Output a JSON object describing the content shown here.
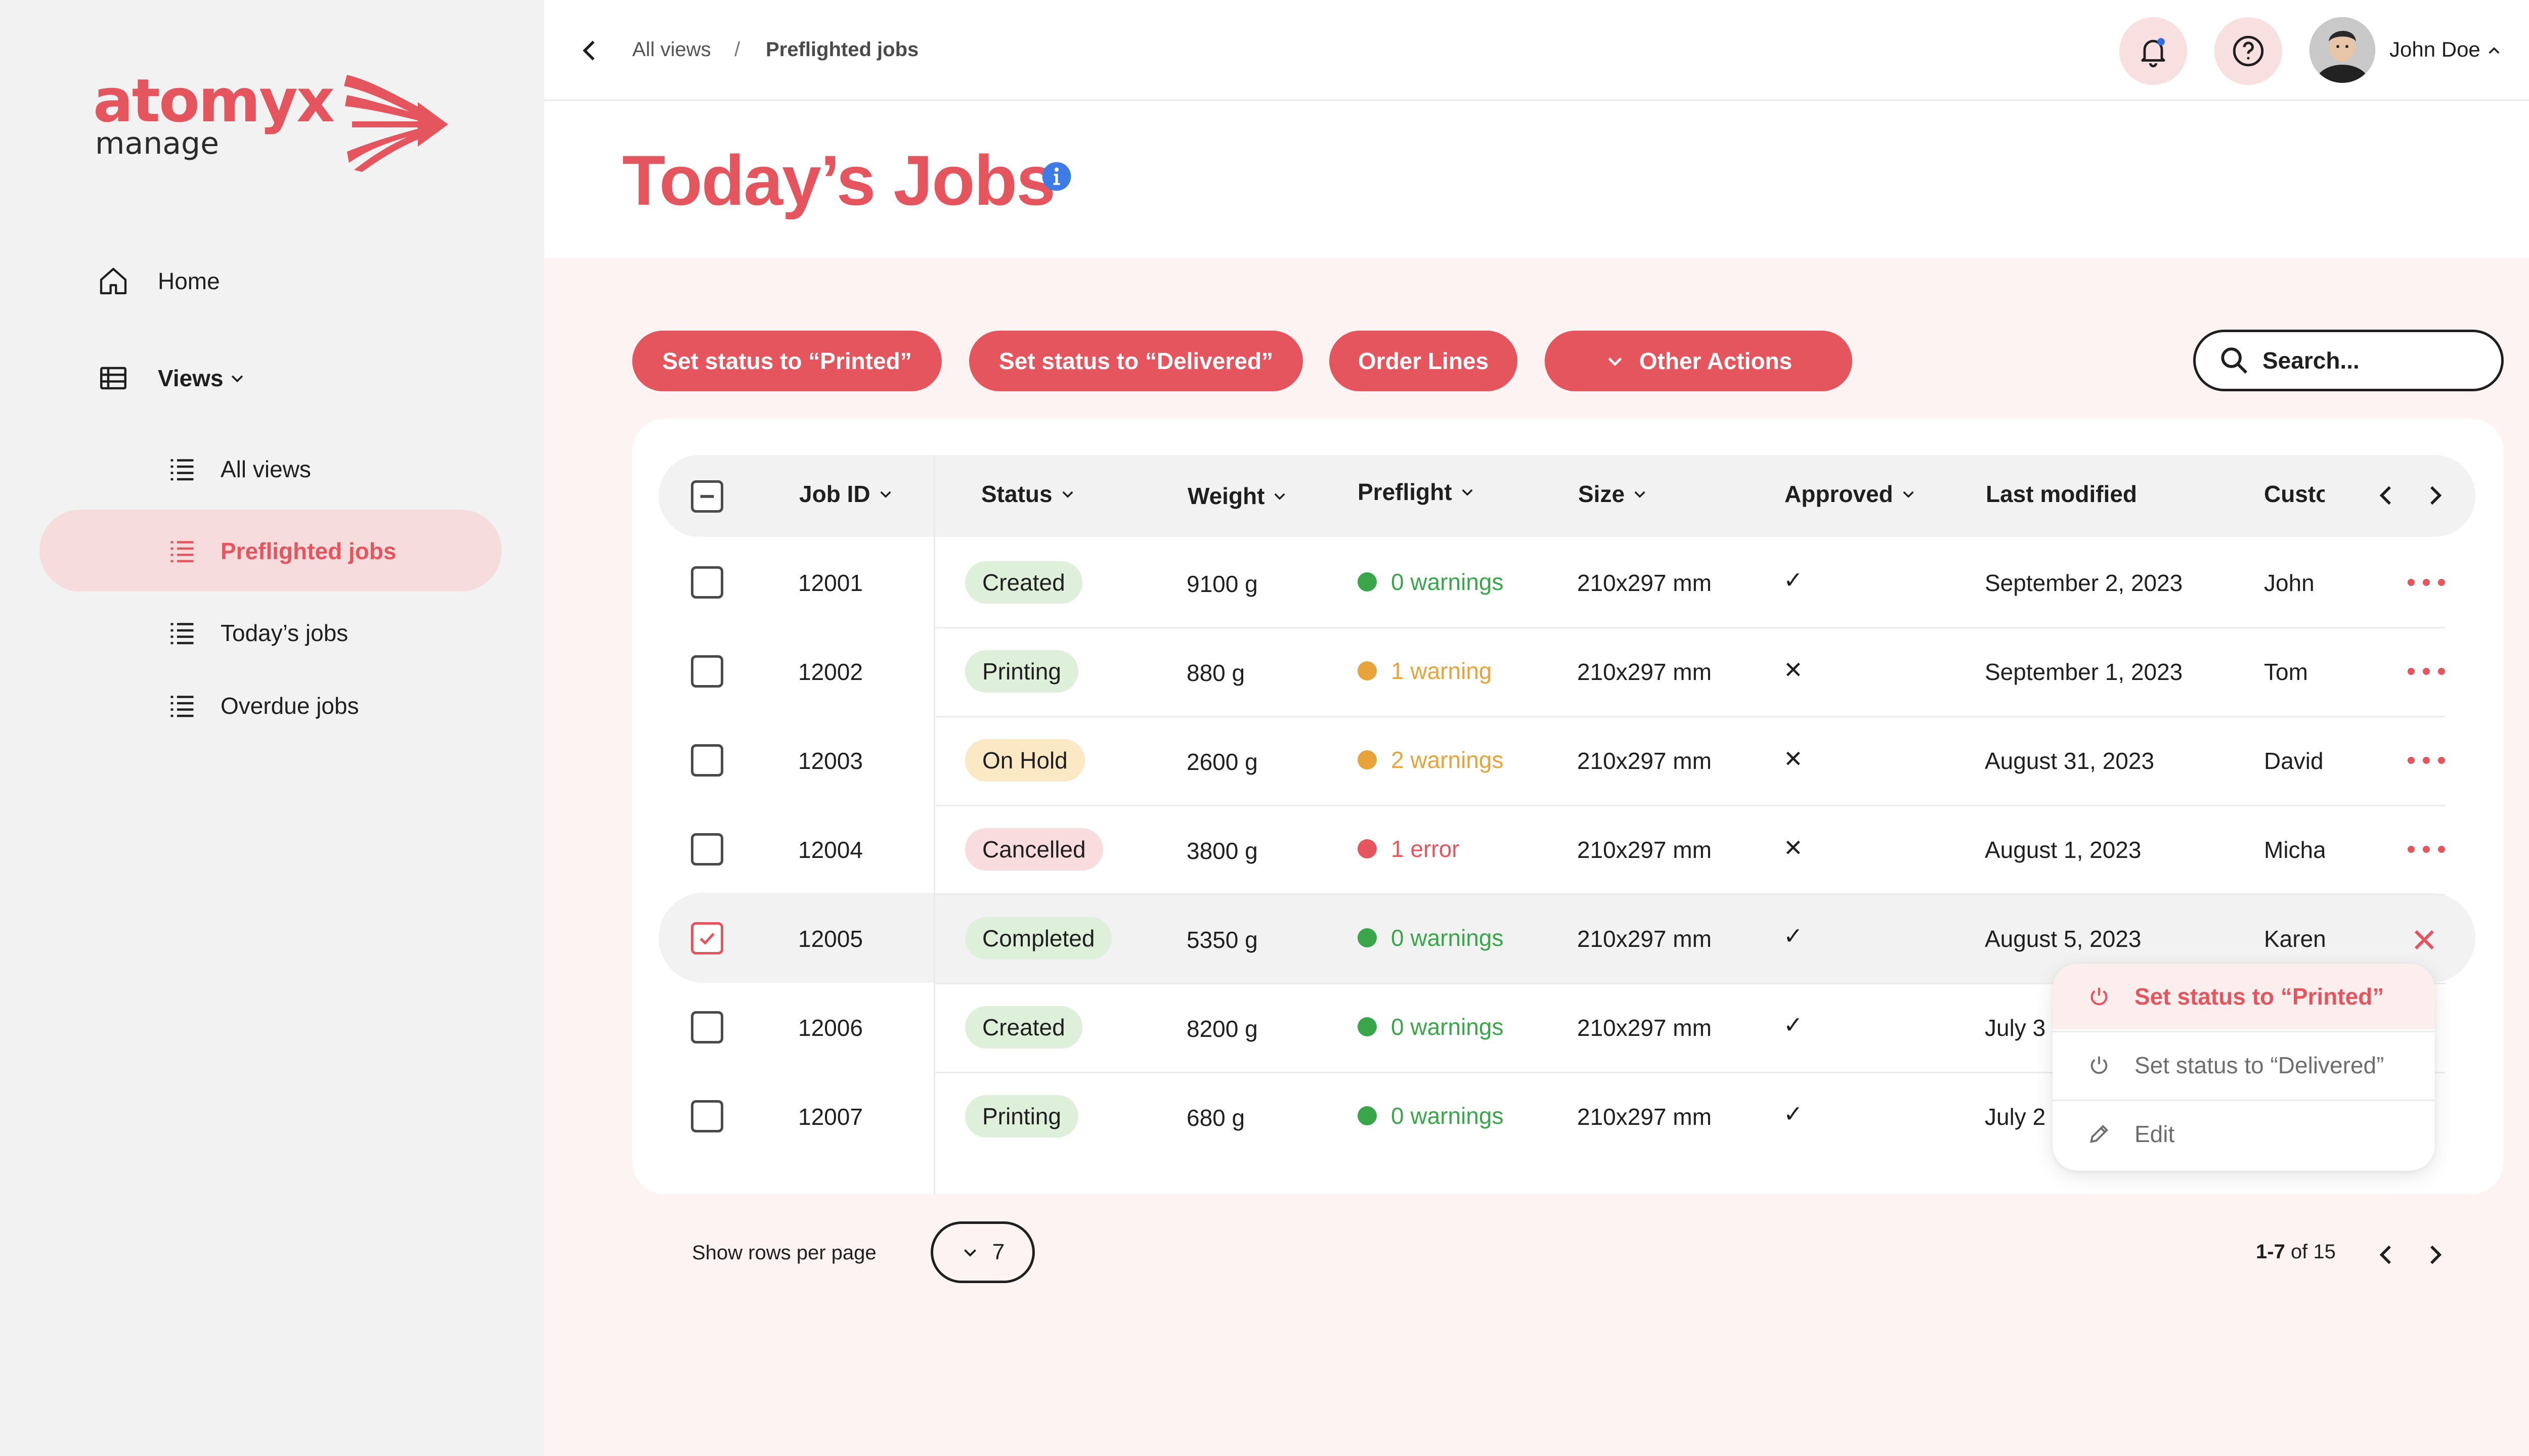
{
  "brand": {
    "name": "atomyx",
    "product": "manage",
    "accent": "#e4555d"
  },
  "sidebar": {
    "home": "Home",
    "views": "Views",
    "items": [
      {
        "label": "All views",
        "icon": "list-icon"
      },
      {
        "label": "Preflighted jobs",
        "icon": "list-icon",
        "active": true
      },
      {
        "label": "Today’s jobs",
        "icon": "list-icon"
      },
      {
        "label": "Overdue jobs",
        "icon": "list-icon"
      }
    ]
  },
  "breadcrumb": {
    "root": "All views",
    "separator": "/",
    "current": "Preflighted jobs"
  },
  "user": {
    "name": "John Doe"
  },
  "page": {
    "title": "Today’s Jobs"
  },
  "actions": {
    "printed": "Set status to “Printed”",
    "delivered": "Set status to “Delivered”",
    "order_lines": "Order Lines",
    "other": "Other Actions"
  },
  "search": {
    "placeholder": "Search..."
  },
  "table": {
    "headers": {
      "job_id": "Job ID",
      "status": "Status",
      "weight": "Weight",
      "preflight": "Preflight",
      "size": "Size",
      "approved": "Approved",
      "last_modified": "Last modified",
      "customer": "Customer"
    },
    "rows": [
      {
        "id": "12001",
        "status": "Created",
        "weight": "9100 g",
        "preflight": "0 warnings",
        "size": "210x297 mm",
        "approved": "✓",
        "modified": "September 2, 2023",
        "customer": "John"
      },
      {
        "id": "12002",
        "status": "Printing",
        "weight": "880 g",
        "preflight": "1 warning",
        "size": "210x297 mm",
        "approved": "✕",
        "modified": "September 1, 2023",
        "customer": "Tom"
      },
      {
        "id": "12003",
        "status": "On Hold",
        "weight": "2600 g",
        "preflight": "2 warnings",
        "size": "210x297 mm",
        "approved": "✕",
        "modified": "August 31, 2023",
        "customer": "David"
      },
      {
        "id": "12004",
        "status": "Cancelled",
        "weight": "3800 g",
        "preflight": "1 error",
        "size": "210x297 mm",
        "approved": "✕",
        "modified": "August 1, 2023",
        "customer": "Michael"
      },
      {
        "id": "12005",
        "status": "Completed",
        "weight": "5350 g",
        "preflight": "0 warnings",
        "size": "210x297 mm",
        "approved": "✓",
        "modified": "August 5, 2023",
        "customer": "Karen",
        "selected": true
      },
      {
        "id": "12006",
        "status": "Created",
        "weight": "8200 g",
        "preflight": "0 warnings",
        "size": "210x297 mm",
        "approved": "✓",
        "modified": "July 3",
        "customer": ""
      },
      {
        "id": "12007",
        "status": "Printing",
        "weight": "680 g",
        "preflight": "0 warnings",
        "size": "210x297 mm",
        "approved": "✓",
        "modified": "July 2",
        "customer": ""
      }
    ]
  },
  "context_menu": {
    "printed": "Set status to “Printed”",
    "delivered": "Set status to “Delivered”",
    "edit": "Edit"
  },
  "footer": {
    "rows_label": "Show rows per page",
    "rows_value": "7",
    "range": "1-7",
    "of_total": "of 15"
  },
  "colors": {
    "created_bg": "#dff0da",
    "printing_bg": "#dff0da",
    "onhold_bg": "#fbe8c4",
    "cancelled_bg": "#f9dcdd",
    "completed_bg": "#dff0da",
    "ok": "#3aa64a",
    "warn": "#e8a33a",
    "error": "#e4555d"
  }
}
